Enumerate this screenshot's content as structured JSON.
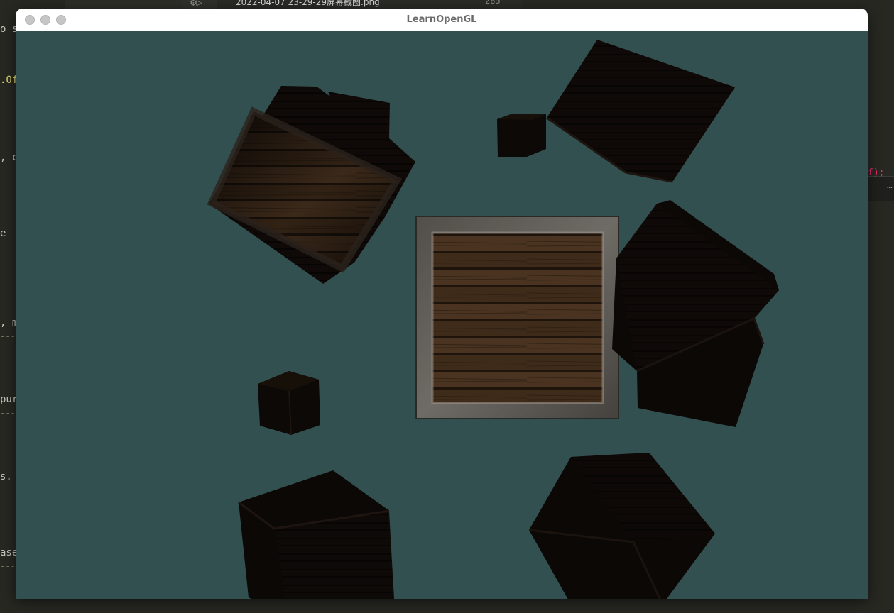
{
  "background_editor": {
    "tab_filename": "2022-04-07 23-29-29屏幕截图.png",
    "tab_line_number": "285",
    "left_code_fragments": [
      "o s",
      ".0f",
      ", c",
      "e",
      ", m",
      "pur",
      "s.",
      "ase"
    ],
    "dash_fragments": [
      "---",
      "---",
      "--",
      "---"
    ],
    "right_code_fragment": "f);",
    "icons": [
      "run-debug-icon",
      "search-icon",
      "more-icon"
    ]
  },
  "window": {
    "title": "LearnOpenGL",
    "controls": [
      "close",
      "minimize",
      "maximize"
    ],
    "clear_color": "#335050",
    "scene": {
      "description_icon": "opengl-render-viewport",
      "objects": [
        "wooden-crate-front-lit",
        "wooden-crate-dark"
      ],
      "crate_count": 9
    }
  },
  "colors": {
    "editor_bg": "#272822",
    "titlebar_bg": "#ffffff",
    "title_text": "#6b6b6b",
    "viewport_bg": "#335050"
  }
}
